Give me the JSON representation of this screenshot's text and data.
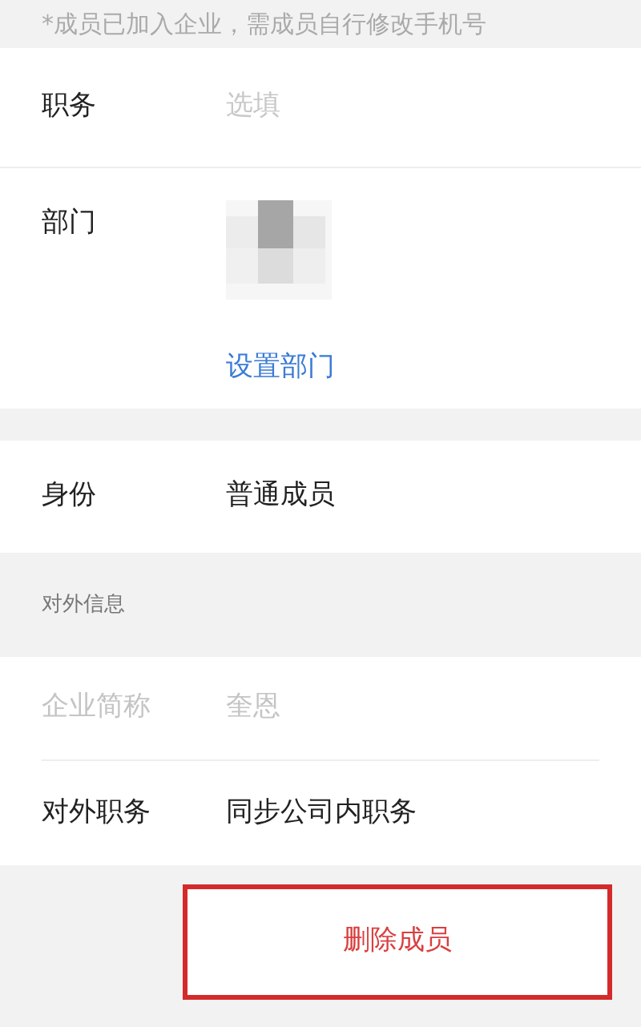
{
  "notice": "*成员已加入企业，需成员自行修改手机号",
  "position": {
    "label": "职务",
    "placeholder": "选填"
  },
  "department": {
    "label": "部门",
    "action": "设置部门"
  },
  "role": {
    "label": "身份",
    "value": "普通成员"
  },
  "external_info": {
    "header": "对外信息",
    "rows": [
      {
        "label": "企业简称",
        "value": "奎恩",
        "disabled": true
      },
      {
        "label": "对外职务",
        "value": "同步公司内职务",
        "disabled": false
      }
    ]
  },
  "delete_button": "删除成员"
}
